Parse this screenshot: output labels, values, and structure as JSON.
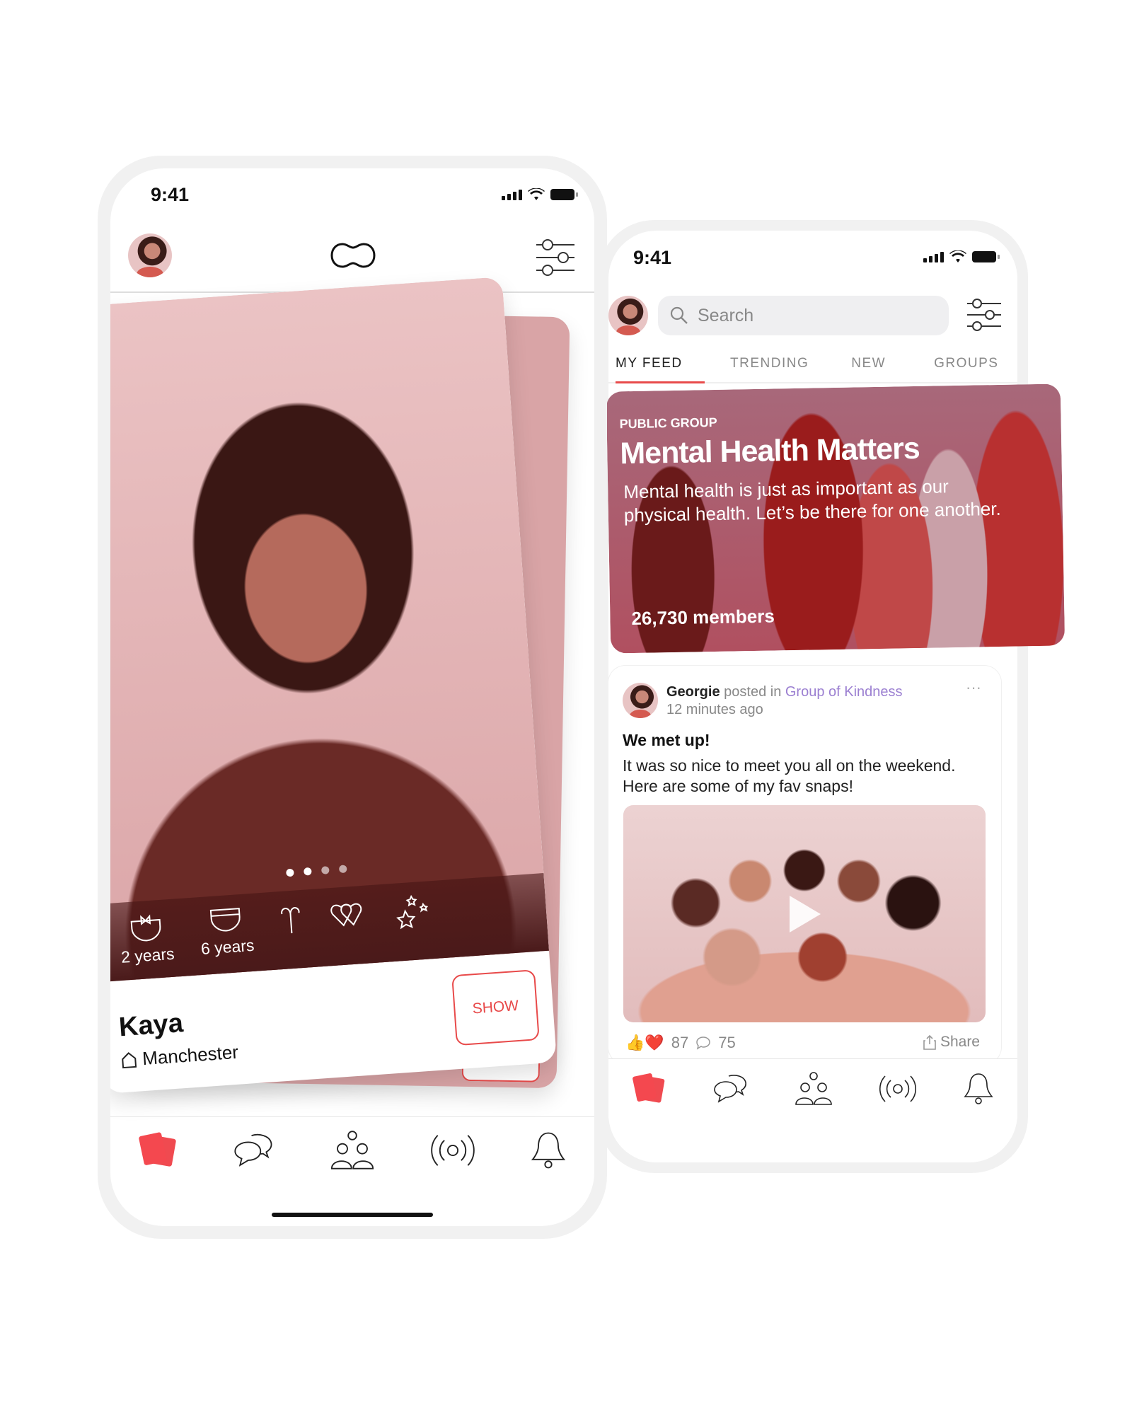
{
  "colors": {
    "accent": "#e84a4a",
    "link": "#9b7fd1",
    "maroon": "#4a1a1a"
  },
  "left_phone": {
    "status": {
      "time": "9:41"
    },
    "header": {
      "logo": "infinity-logo-icon",
      "filter": "sliders-icon"
    },
    "profile": {
      "name": "Kaya",
      "location": "Manchester",
      "location_icon": "home-icon",
      "photo_index": 2,
      "photo_count": 4,
      "attributes": [
        {
          "icon": "diaper-bow-icon",
          "label": "2 years"
        },
        {
          "icon": "diaper-icon",
          "label": "6 years"
        },
        {
          "icon": "aries-icon",
          "label": ""
        },
        {
          "icon": "double-heart-icon",
          "label": ""
        },
        {
          "icon": "stars-icon",
          "label": ""
        }
      ],
      "show_label": "SHOW"
    },
    "nav": [
      "cards-icon",
      "chat-icon",
      "community-icon",
      "broadcast-icon",
      "bell-icon"
    ]
  },
  "right_phone": {
    "status": {
      "time": "9:41"
    },
    "search": {
      "placeholder": "Search"
    },
    "tabs": [
      {
        "label": "MY FEED",
        "active": true
      },
      {
        "label": "TRENDING"
      },
      {
        "label": "NEW"
      },
      {
        "label": "GROUPS"
      }
    ],
    "group": {
      "type": "PUBLIC GROUP",
      "title": "Mental Health Matters",
      "description": "Mental health is just as important as our physical health. Let’s be there for one another.",
      "members": "26,730 members"
    },
    "post": {
      "author": "Georgie",
      "posted_in": "posted in",
      "group": "Group of Kindness",
      "time": "12 minutes ago",
      "title": "We met up!",
      "body": "It was so nice to meet you all on the weekend. Here are some of my fav snaps!",
      "reactions": "👍❤️",
      "reaction_count": "87",
      "comment_count": "75",
      "share_label": "Share",
      "more": "···"
    },
    "nav": [
      "cards-icon",
      "chat-icon",
      "community-icon",
      "broadcast-icon",
      "bell-icon"
    ]
  }
}
